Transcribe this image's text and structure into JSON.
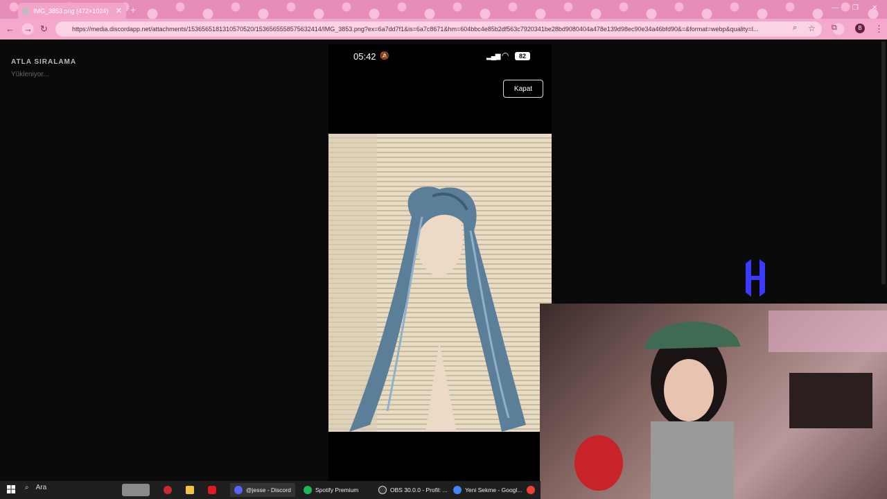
{
  "browser": {
    "tab_title": "IMG_3853.png (472×1024)",
    "url": "https://media.discordapp.net/attachments/1536565181310570520/1536565558575632414/IMG_3853.png?ex=6a7dd7f1&is=6a7c8671&hm=604bbc4e85b2df563c7920341be28bd9080404a478e139d98ec90e34a46bfd90&=&format=webp&quality=l...",
    "profile_initial": "B"
  },
  "left_panel": {
    "heading": "ATLA SIRALAMA",
    "status": "Yükleniyor..."
  },
  "phone": {
    "time": "05:42",
    "battery": "82",
    "close_button": "Kapat"
  },
  "taskbar": {
    "search_label": "Ara",
    "items": [
      {
        "label": "@jesse - Discord",
        "color": "#5865f2"
      },
      {
        "label": "Spotify Premium",
        "color": "#1db954"
      },
      {
        "label": "OBS 30.0.0 - Profil: ...",
        "color": "#333333"
      },
      {
        "label": "Yeni Sekme - Googl...",
        "color": "#4285f4"
      }
    ]
  },
  "colors": {
    "chrome_pink": "#e58db8",
    "logo_blue": "#3b3bff"
  }
}
